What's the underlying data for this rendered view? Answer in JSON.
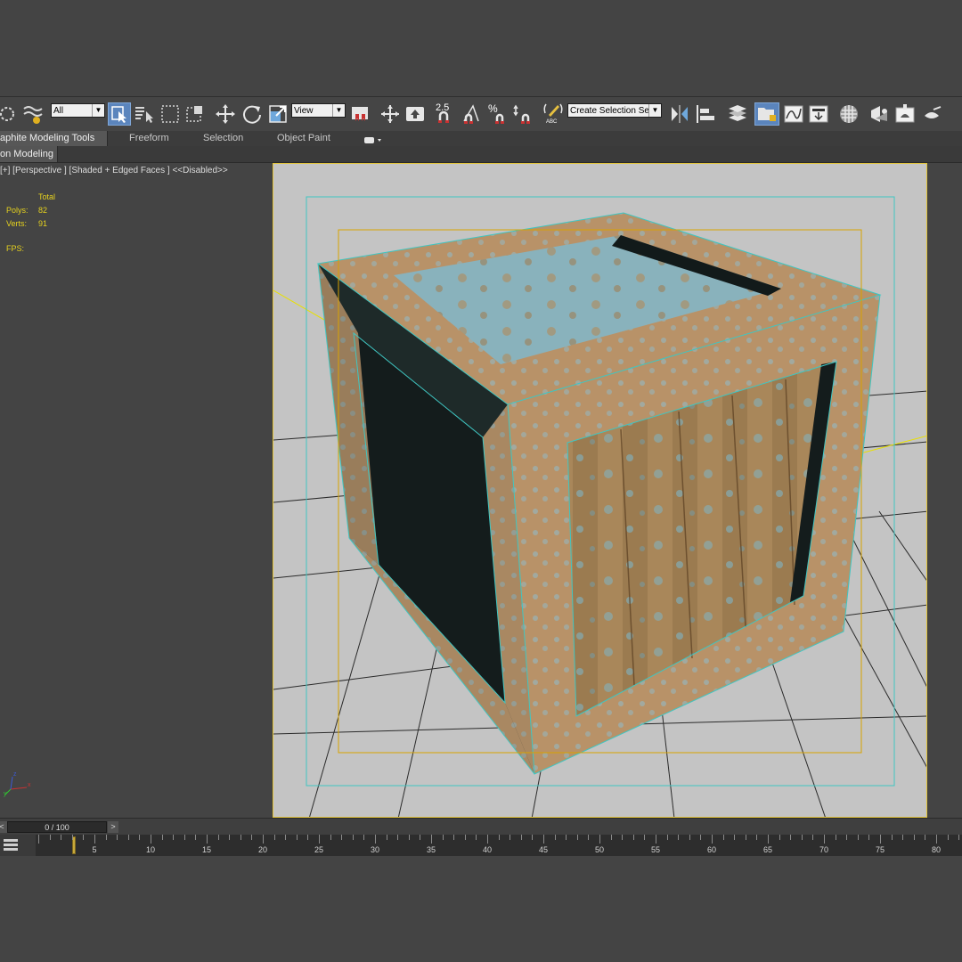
{
  "toolbar": {
    "filter_value": "All",
    "view_value": "View",
    "snap_value": "2.5",
    "angle_label": "A",
    "percent_label": "%",
    "selection_set_value": "Create Selection Se",
    "abc_label": "ABC",
    "accent_color": "#5b85bd"
  },
  "ribbon": {
    "tabs": [
      {
        "label": "aphite Modeling Tools"
      },
      {
        "label": "Freeform"
      },
      {
        "label": "Selection"
      },
      {
        "label": "Object Paint"
      }
    ]
  },
  "subbar": {
    "label": "on Modeling"
  },
  "viewport": {
    "label": "[+] [Perspective ] [Shaded + Edged Faces ]  <<Disabled>>",
    "stats_header": "Total",
    "polys_label": "Polys:",
    "polys_value": "82",
    "verts_label": "Verts:",
    "verts_value": "91",
    "fps_label": "FPS:",
    "axis_labels": {
      "x": "x",
      "y": "y",
      "z": "z"
    },
    "background_color": "#c4c4c4",
    "border_color": "#e3c53b"
  },
  "timeline": {
    "slider_text": "0 / 100",
    "prev": "<",
    "next": ">",
    "ticks": [
      "5",
      "10",
      "15",
      "20",
      "25",
      "30",
      "35",
      "40",
      "45",
      "50",
      "55",
      "60",
      "65",
      "70",
      "75",
      "80"
    ]
  }
}
